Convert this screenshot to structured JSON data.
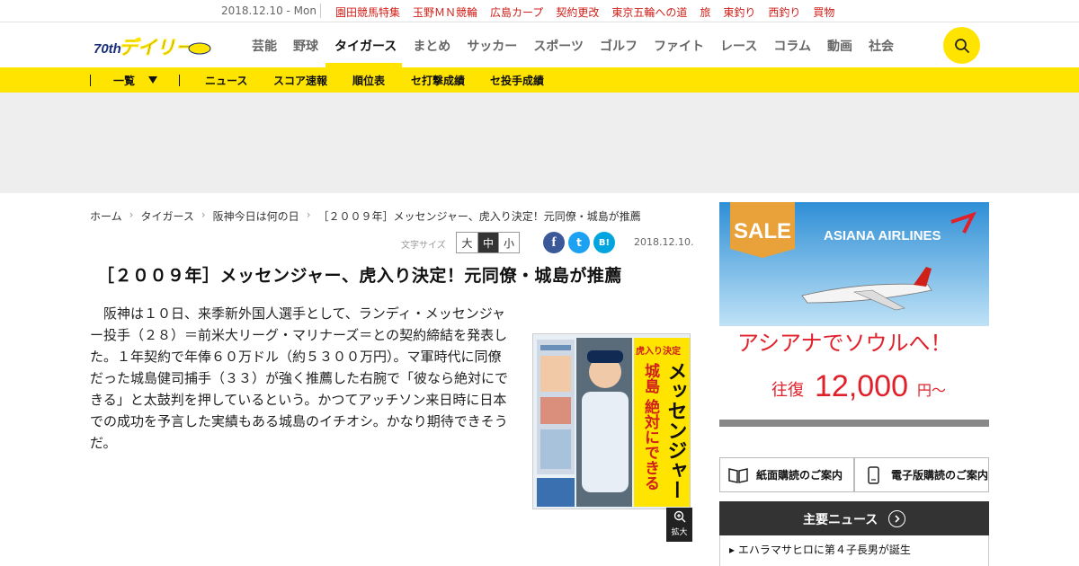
{
  "topbar": {
    "date": "2018.12.10 - Mon",
    "links": [
      "園田競馬特集",
      "玉野ＭＮ競輪",
      "広島カープ",
      "契約更改",
      "東京五輪への道",
      "旅",
      "東釣り",
      "西釣り",
      "買物"
    ]
  },
  "header": {
    "logo_text": "デイリー",
    "logo_badge": "70th",
    "nav": [
      "芸能",
      "野球",
      "タイガース",
      "まとめ",
      "サッカー",
      "スポーツ",
      "ゴルフ",
      "ファイト",
      "レース",
      "コラム",
      "動画",
      "社会"
    ],
    "active_nav": "タイガース",
    "search_icon": "search-icon"
  },
  "subnav": {
    "items": [
      "一覧",
      "ニュース",
      "スコア速報",
      "順位表",
      "セ打撃成績",
      "セ投手成績"
    ]
  },
  "breadcrumb": [
    "ホーム",
    "タイガース",
    "阪神今日は何の日",
    "［２００９年］メッセンジャー、虎入り決定！元同僚・城島が推薦"
  ],
  "tools": {
    "font_size_label": "文字サイズ",
    "sizes": [
      "大",
      "中",
      "小"
    ],
    "active_size": "中",
    "share": [
      "f",
      "t",
      "B!"
    ],
    "date": "2018.12.10."
  },
  "article": {
    "headline": "［２００９年］メッセンジャー、虎入り決定！元同僚・城島が推薦",
    "body": "阪神は１０日、来季新外国人選手として、ランディ・メッセンジャー投手（２８）＝前米大リーグ・マリナーズ＝との契約締結を発表した。１年契約で年俸６０万ドル（約５３００万円）。マ軍時代に同僚だった城島健司捕手（３３）が強く推薦した右腕で「彼なら絶対にできる」と太鼓判を押しているという。かつてアッチソン来日時に日本での成功を予言した実績もある城島のイチオシ。かなり期待できそうだ。",
    "paper_headline": "メッセンジャー",
    "paper_sub": "城島 絶対にできる",
    "paper_tag": "虎入り決定",
    "zoom_label": "拡大"
  },
  "side_ad": {
    "sale": "SALE",
    "airline": "ASIANA AIRLINES",
    "copy": "アシアナでソウルへ！",
    "price_prefix": "往復",
    "price": "12,000",
    "price_suffix": "円～"
  },
  "subscribe": {
    "paper": "紙面購読のご案内",
    "digital": "電子版購読のご案内"
  },
  "main_news": {
    "title": "主要ニュース",
    "items": [
      "エハラマサヒロに第４子長男が誕生"
    ]
  },
  "colors": {
    "brand_yellow": "#ffe400",
    "link_red": "#d0201a",
    "facebook": "#3b5998",
    "twitter": "#1da1f2",
    "hatena": "#00a4de"
  }
}
